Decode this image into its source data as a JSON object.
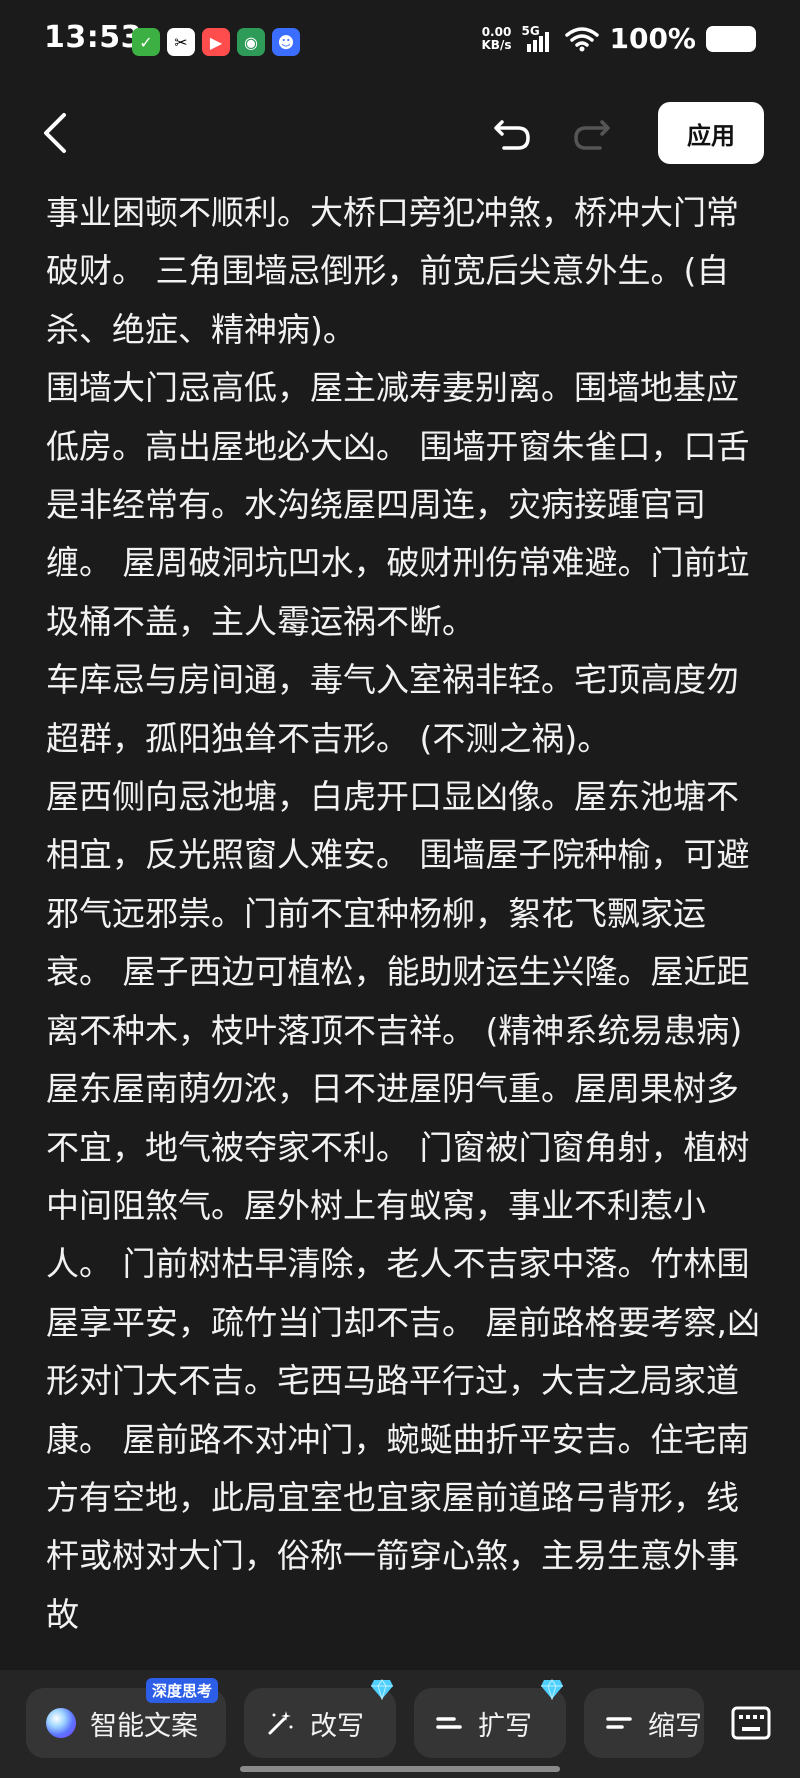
{
  "status_bar": {
    "time": "13:53",
    "net_speed_value": "0.00",
    "net_speed_unit": "KB/s",
    "network_type": "5G",
    "battery": "100%",
    "app_icons": [
      "checklist-app-icon",
      "capcut-app-icon",
      "video-app-icon",
      "green-app-icon",
      "baidu-app-icon"
    ]
  },
  "toolbar": {
    "apply_label": "应用"
  },
  "content": {
    "paragraphs": [
      "事业困顿不顺利。大桥口旁犯冲煞，桥冲大门常破财。 三角围墙忌倒形，前宽后尖意外生。(自杀、绝症、精神病)。",
      "围墙大门忌高低，屋主减寿妻别离。围墙地基应低房。高出屋地必大凶。 围墙开窗朱雀口，口舌是非经常有。水沟绕屋四周连，灾病接踵官司缠。 屋周破洞坑凹水，破财刑伤常难避。门前垃圾桶不盖，主人霉运祸不断。",
      "车库忌与房间通，毒气入室祸非轻。宅顶高度勿超群，孤阳独耸不吉形。 (不测之祸)。",
      "屋西侧向忌池塘，白虎开口显凶像。屋东池塘不相宜，反光照窗人难安。 围墙屋子院种榆，可避邪气远邪祟。门前不宜种杨柳，絮花飞飘家运衰。 屋子西边可植松，能助财运生兴隆。屋近距离不种木，枝叶落顶不吉祥。 (精神系统易患病)",
      "屋东屋南荫勿浓，日不进屋阴气重。屋周果树多不宜，地气被夺家不利。 门窗被门窗角射，植树中间阻煞气。屋外树上有蚁窝，事业不利惹小人。 门前树枯早清除，老人不吉家中落。竹林围屋享平安，疏竹当门却不吉。 屋前路格要考察,凶形对门大不吉。宅西马路平行过，大吉之局家道康。 屋前路不对冲门，蜿蜒曲折平安吉。住宅南方有空地，此局宜室也宜家屋前道路弓背形，线杆或树对大门，俗称一箭穿心煞，主易生意外事故"
    ]
  },
  "bottom_bar": {
    "smart_copy_label": "智能文案",
    "smart_copy_badge": "深度思考",
    "rewrite_label": "改写",
    "expand_label": "扩写",
    "shorten_label": "缩写"
  }
}
